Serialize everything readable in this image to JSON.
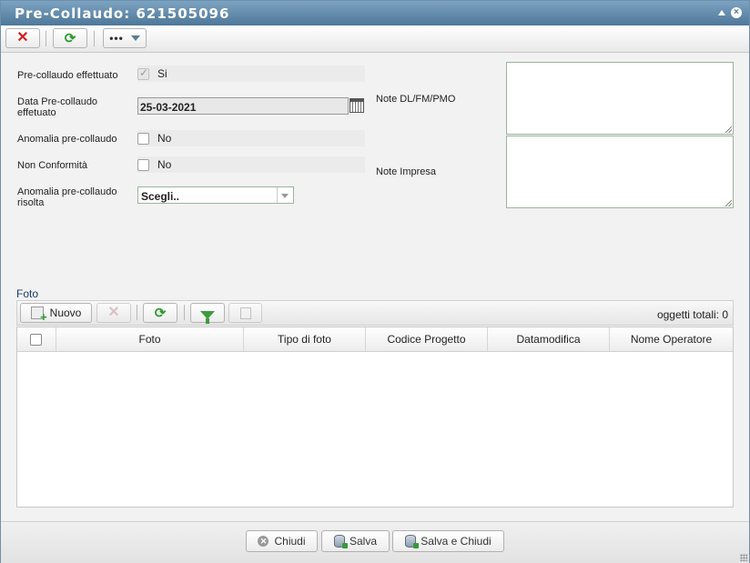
{
  "window": {
    "title": "Pre-Collaudo: 621505096"
  },
  "form": {
    "pre_collaudo_effettuato": {
      "label": "Pre-collaudo effettuato",
      "value": "Si",
      "checked": true
    },
    "data_pre_collaudo": {
      "label_line1": "Data Pre-collaudo",
      "label_line2": "effetuato",
      "value": "25-03-2021"
    },
    "anomalia_pre_collaudo": {
      "label": "Anomalia pre-collaudo",
      "value": "No",
      "checked": false
    },
    "non_conformita": {
      "label": "Non Conformità",
      "value": "No",
      "checked": false
    },
    "anomalia_risolta": {
      "label_line1": "Anomalia pre-collaudo",
      "label_line2": "risolta",
      "value": "Scegli.."
    },
    "note_dl": {
      "label": "Note DL/FM/PMO",
      "value": ""
    },
    "note_impresa": {
      "label": "Note Impresa",
      "value": ""
    }
  },
  "foto": {
    "section_title": "Foto",
    "new_label": "Nuovo",
    "total_label": "oggetti totali: 0",
    "columns": [
      "Foto",
      "Tipo di foto",
      "Codice Progetto",
      "Datamodifica",
      "Nome Operatore"
    ],
    "rows": []
  },
  "footer": {
    "close_label": "Chiudi",
    "save_label": "Salva",
    "save_close_label": "Salva e Chiudi"
  }
}
